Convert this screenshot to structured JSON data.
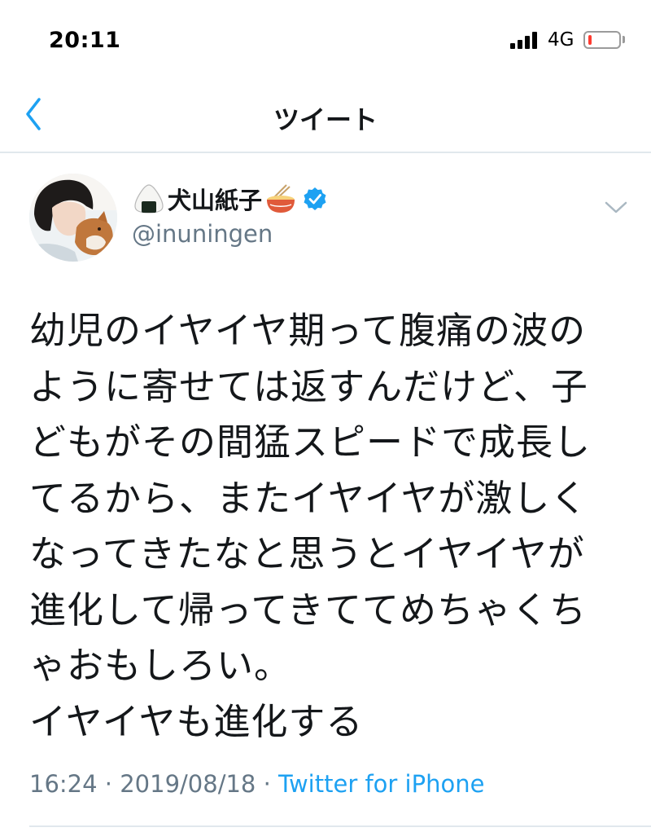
{
  "status_bar": {
    "time": "20:11",
    "network": "4G",
    "battery_level_fraction": 0.1
  },
  "nav": {
    "title": "ツイート",
    "back_icon": "chevron-left-icon"
  },
  "tweet": {
    "display_name": "犬山紙子",
    "name_prefix_emoji": "onigiri-icon",
    "name_suffix_emoji": "ramen-icon",
    "verified": true,
    "handle": "@inuningen",
    "text": "幼児のイヤイヤ期って腹痛の波の\nように寄せては返すんだけど、子\nどもがその間猛スピードで成長し\nてるから、またイヤイヤが激しく\nなってきたなと思うとイヤイヤが\n進化して帰ってきててめちゃくち\nゃおもしろい。\nイヤイヤも進化する",
    "time": "16:24",
    "date": "2019/08/18",
    "separator": "·",
    "source": "Twitter for iPhone"
  },
  "colors": {
    "accent": "#1da1f2",
    "secondary_text": "#657786",
    "divider": "#e1e8ed",
    "battery_low": "#ff3b30"
  }
}
